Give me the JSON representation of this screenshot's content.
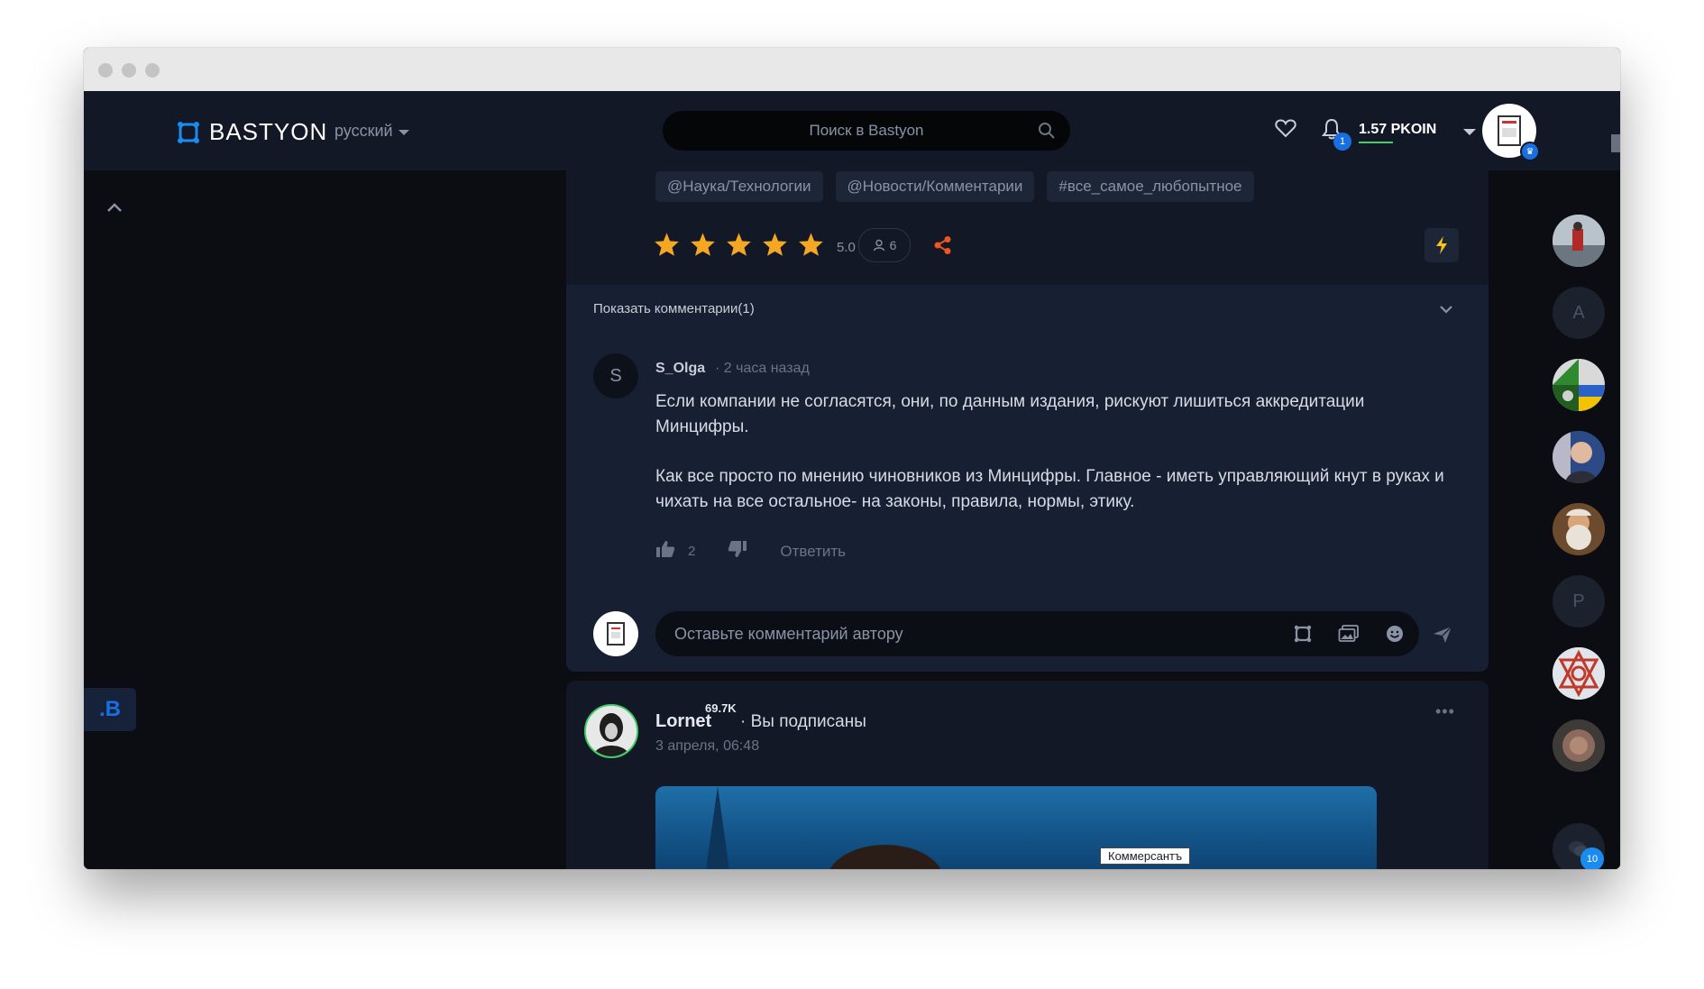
{
  "header": {
    "logo_text": "BASTYON",
    "language": "русский",
    "search_placeholder": "Поиск в Bastyon",
    "notifications_count": "1",
    "balance": "1.57 PKOIN"
  },
  "post": {
    "tags": [
      "@Наука/Технологии",
      "@Новости/Комментарии",
      "#все_самое_любопытное"
    ],
    "rating": 5,
    "rating_value": "5.0",
    "raters_count": "6",
    "show_comments_label": "Показать комментарии(1)",
    "comment": {
      "avatar_letter": "S",
      "author": "S_Olga",
      "time": "· 2 часа назад",
      "paragraphs": [
        "Если компании не согласятся, они, по данным издания, рискуют лишиться аккредитации Минцифры.",
        "Как все просто по мнению чиновников из Минцифры. Главное - иметь управляющий кнут в руках и чихать на все остальное- на законы, правила, нормы, этику."
      ],
      "likes": "2",
      "reply_label": "Ответить"
    },
    "comment_placeholder": "Оставьте комментарий автору"
  },
  "post2": {
    "author": "Lornet",
    "reputation": "69.7K",
    "subscribed": "· Вы подписаны",
    "date": "3 апреля, 06:48",
    "menu": "•••",
    "image_label": "Коммерсантъ"
  },
  "sidebar_left": {
    "b_label": ".B"
  },
  "rail": {
    "letters": [
      "A",
      "P"
    ],
    "chat_badge": "10"
  },
  "colors": {
    "brand": "#1a6fe0",
    "star": "#f5a623",
    "share": "#f0561d",
    "balance_underline": "#3ecf68"
  }
}
